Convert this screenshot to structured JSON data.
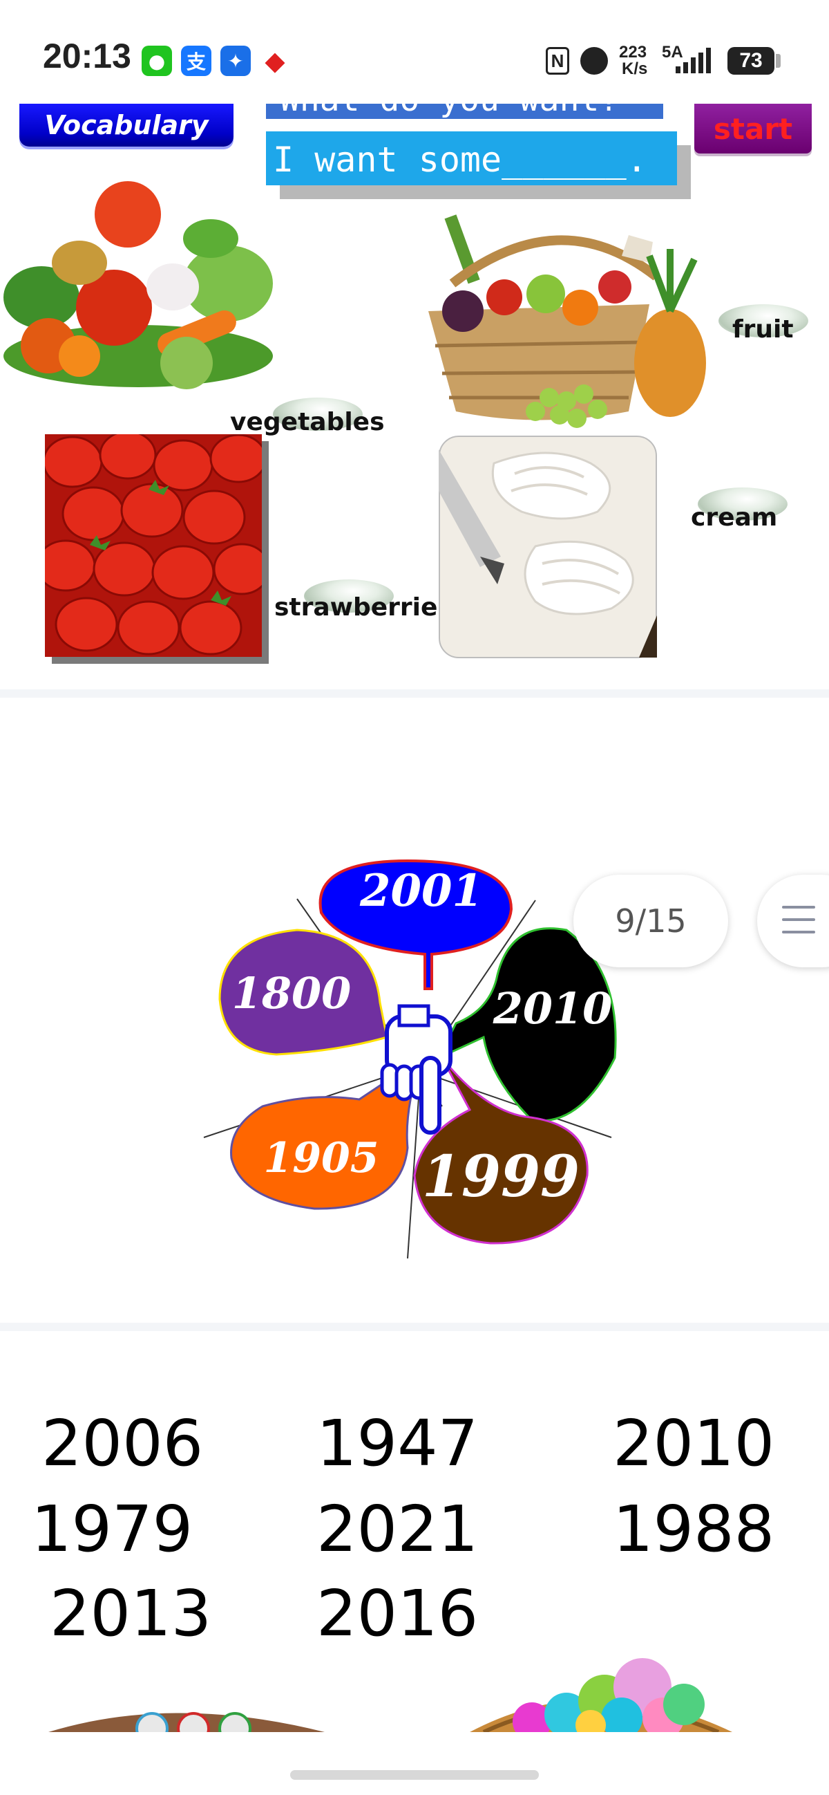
{
  "status_bar": {
    "time": "20:13",
    "app_icons": [
      "wechat-icon",
      "alipay-icon",
      "bulb-app-icon",
      "red-diamond-app-icon"
    ],
    "net_speed_value": "223",
    "net_speed_unit": "K/s",
    "signal_label": "5A",
    "battery": "73"
  },
  "slide1": {
    "vocab_label": "Vocabulary",
    "question": "What do you want?",
    "answer": "I want some______.",
    "start_label": "start",
    "words": {
      "vegetables": "vegetables",
      "fruit": "fruit",
      "strawberries": "strawberries",
      "cream": "cream"
    }
  },
  "slide2": {
    "petals": [
      "2001",
      "1800",
      "2010",
      "1905",
      "1999"
    ],
    "page_indicator": "9/15",
    "colors": {
      "blue": "#0000ff",
      "purple": "#7030a0",
      "black": "#000000",
      "orange": "#ff6600",
      "brown": "#663300"
    }
  },
  "slide3": {
    "years": [
      "2006",
      "1947",
      "2010",
      "1979",
      "2021",
      "1988",
      "2013",
      "2016"
    ]
  }
}
